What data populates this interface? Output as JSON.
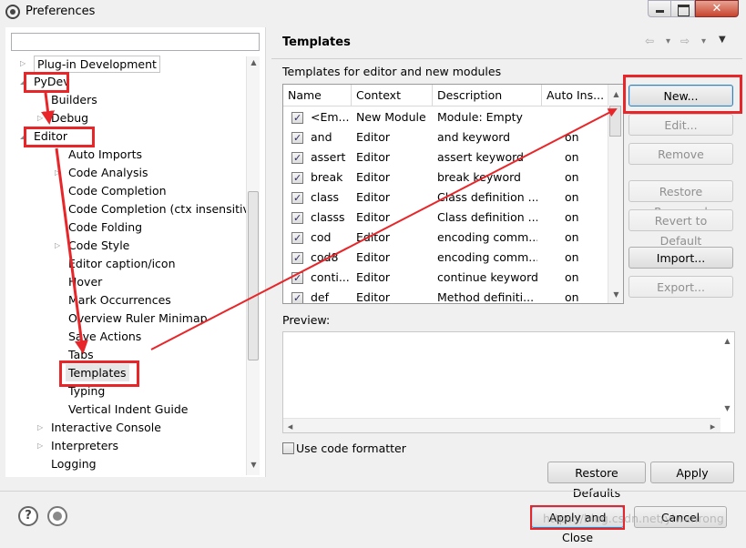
{
  "window": {
    "title": "Preferences",
    "close_glyph": "✕"
  },
  "filter": {
    "value": ""
  },
  "tree": [
    {
      "label": "Plug-in Development",
      "twisty": "▷"
    },
    {
      "label": "PyDev",
      "twisty": "◢"
    },
    {
      "label": "Builders",
      "twisty": ""
    },
    {
      "label": "Debug",
      "twisty": "▷"
    },
    {
      "label": "Editor",
      "twisty": "◢"
    },
    {
      "label": "Auto Imports",
      "twisty": ""
    },
    {
      "label": "Code Analysis",
      "twisty": "▷"
    },
    {
      "label": "Code Completion",
      "twisty": ""
    },
    {
      "label": "Code Completion (ctx insensitive",
      "twisty": ""
    },
    {
      "label": "Code Folding",
      "twisty": ""
    },
    {
      "label": "Code Style",
      "twisty": "▷"
    },
    {
      "label": "Editor caption/icon",
      "twisty": ""
    },
    {
      "label": "Hover",
      "twisty": ""
    },
    {
      "label": "Mark Occurrences",
      "twisty": ""
    },
    {
      "label": "Overview Ruler Minimap",
      "twisty": ""
    },
    {
      "label": "Save Actions",
      "twisty": ""
    },
    {
      "label": "Tabs",
      "twisty": ""
    },
    {
      "label": "Templates",
      "twisty": ""
    },
    {
      "label": "Typing",
      "twisty": ""
    },
    {
      "label": "Vertical Indent Guide",
      "twisty": ""
    },
    {
      "label": "Interactive Console",
      "twisty": "▷"
    },
    {
      "label": "Interpreters",
      "twisty": "▷"
    },
    {
      "label": "Logging",
      "twisty": ""
    }
  ],
  "page": {
    "title": "Templates",
    "subtitle": "Templates for editor and new modules",
    "nav": {
      "back": "⇦",
      "back_menu": "▾",
      "forward": "⇨",
      "forward_menu": "▾",
      "view_menu": "▼"
    }
  },
  "table": {
    "headers": [
      "Name",
      "Context",
      "Description",
      "Auto Ins..."
    ],
    "rows": [
      {
        "checked": true,
        "name": "<Em...",
        "context": "New Module",
        "description": "Module: Empty",
        "auto": ""
      },
      {
        "checked": true,
        "name": "and",
        "context": "Editor",
        "description": "and keyword",
        "auto": "on"
      },
      {
        "checked": true,
        "name": "assert",
        "context": "Editor",
        "description": "assert keyword",
        "auto": "on"
      },
      {
        "checked": true,
        "name": "break",
        "context": "Editor",
        "description": "break keyword",
        "auto": "on"
      },
      {
        "checked": true,
        "name": "class",
        "context": "Editor",
        "description": "Class definition ...",
        "auto": "on"
      },
      {
        "checked": true,
        "name": "classs",
        "context": "Editor",
        "description": "Class definition ...",
        "auto": "on"
      },
      {
        "checked": true,
        "name": "cod",
        "context": "Editor",
        "description": "encoding comm...",
        "auto": "on"
      },
      {
        "checked": true,
        "name": "cod8",
        "context": "Editor",
        "description": "encoding comm...",
        "auto": "on"
      },
      {
        "checked": true,
        "name": "conti...",
        "context": "Editor",
        "description": "continue keyword",
        "auto": "on"
      },
      {
        "checked": true,
        "name": "def",
        "context": "Editor",
        "description": "Method definiti...",
        "auto": "on"
      }
    ]
  },
  "side_buttons": {
    "new": "New...",
    "edit": "Edit...",
    "remove": "Remove",
    "restore_removed": "Restore Removed",
    "revert_to_default": "Revert to Default",
    "import": "Import...",
    "export": "Export..."
  },
  "preview": {
    "label": "Preview:",
    "text": ""
  },
  "use_code_formatter": {
    "label": "Use code formatter",
    "checked": false
  },
  "page_buttons": {
    "restore_defaults": "Restore Defaults",
    "apply": "Apply"
  },
  "dialog_buttons": {
    "apply_and_close": "Apply and Close",
    "cancel": "Cancel"
  },
  "help": {
    "glyph": "?"
  },
  "scroll_glyphs": {
    "up": "▲",
    "down": "▼",
    "left": "◂",
    "right": "▸"
  },
  "watermark": "https://blog.csdn.net/yiwenrong",
  "annotation_color": "#e8262a"
}
